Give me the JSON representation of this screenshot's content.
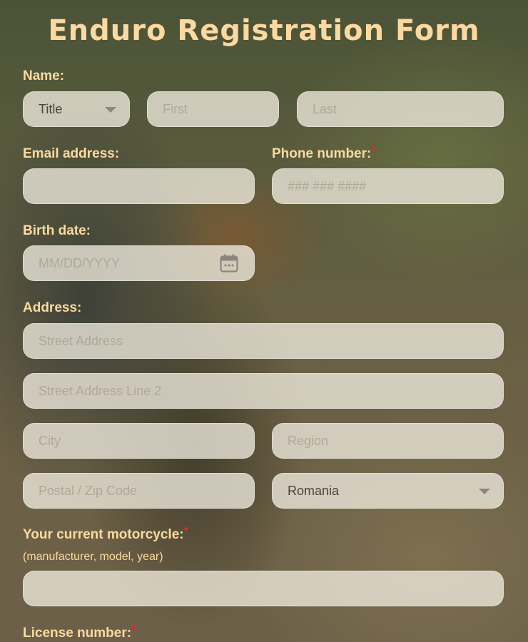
{
  "title": "Enduro Registration Form",
  "name": {
    "label": "Name:",
    "title_select": "Title",
    "first_placeholder": "First",
    "last_placeholder": "Last"
  },
  "email": {
    "label": "Email address:",
    "value": ""
  },
  "phone": {
    "label": "Phone number:",
    "required": "*",
    "placeholder": "### ### ####"
  },
  "birth": {
    "label": "Birth date:",
    "placeholder": "MM/DD/YYYY"
  },
  "address": {
    "label": "Address:",
    "street_placeholder": "Street Address",
    "street2_placeholder": "Street Address Line 2",
    "city_placeholder": "City",
    "region_placeholder": "Region",
    "postal_placeholder": "Postal / Zip Code",
    "country": "Romania"
  },
  "motorcycle": {
    "label": "Your current motorcycle:",
    "required": "*",
    "sublabel": "(manufacturer, model, year)",
    "value": ""
  },
  "license": {
    "label": "License number:",
    "required": "*"
  },
  "colors": {
    "accent": "#fcd9a0",
    "required": "#e0262a",
    "field_bg": "#f0eade"
  }
}
